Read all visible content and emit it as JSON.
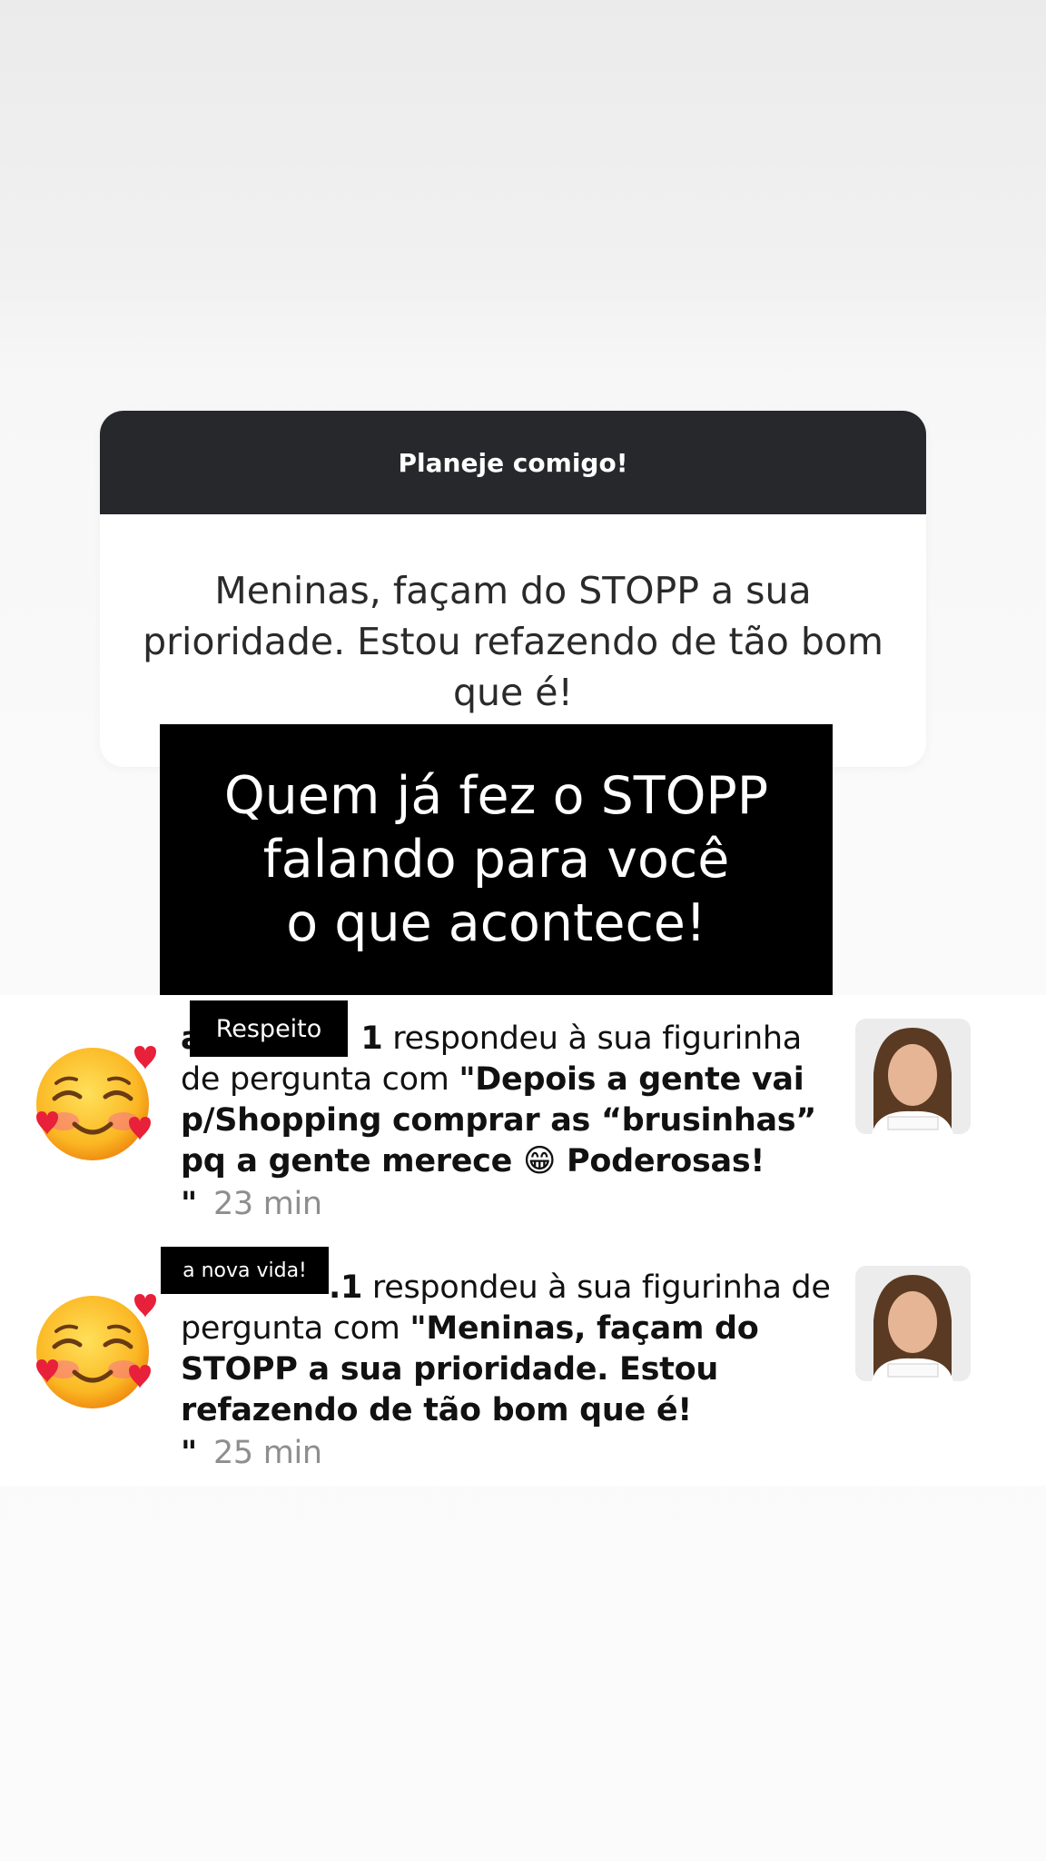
{
  "question_card": {
    "header": "Planeje comigo!",
    "answer": "Meninas, façam do STOPP a sua prioridade. Estou refazendo de tão bom que é!"
  },
  "overlay": {
    "line1": "Quem já fez o STOPP",
    "line2": "falando para você",
    "line3": "o que acontece!"
  },
  "activities": [
    {
      "avatar_icon": "smiling-face-with-hearts-icon",
      "redaction_label": "Respeito",
      "username_visible_start": "a",
      "username_visible_end": "1",
      "action": "respondeu à sua figurinha de pergunta com",
      "quote_open": "\"",
      "response_part1": "Depois a gente vai p/Shopping comprar as “brusinhas” pq a gente merece ",
      "response_emoji": "😁",
      "response_part2": " Poderosas!",
      "quote_close": "\"",
      "time": "23 min"
    },
    {
      "avatar_icon": "smiling-face-with-hearts-icon",
      "redaction_label": "a nova vida!",
      "username_visible_end": ".1",
      "action": "respondeu à sua figurinha de pergunta com",
      "quote_open": "\"",
      "response": "Meninas, façam do STOPP a sua prioridade. Estou refazendo de tão bom que é!",
      "quote_close": "\"",
      "time": "25 min"
    }
  ],
  "colors": {
    "card_header_bg": "#26282c",
    "overlay_bg": "#000000",
    "timestamp": "#8e8e8e"
  }
}
